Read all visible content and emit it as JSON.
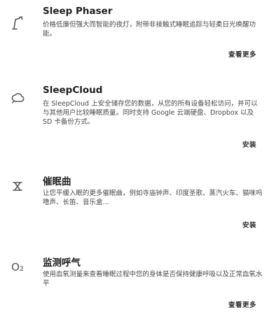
{
  "items": [
    {
      "icon": "lamp-icon",
      "title": "Sleep Phaser",
      "description": "价格低廉但强大而智能的夜灯，附带非接触式睡眠追踪与轻柔日光唤醒功能。",
      "action": "查看更多"
    },
    {
      "icon": "cloud-icon",
      "title": "SleepCloud",
      "description": "在 SleepCloud 上安全储存您的数据，从您的所有设备轻松访问，并可以与其他用户比较睡眠质量。同时支持 Google 云端硬盘、Dropbox 以及 SD 卡备份方式。",
      "action": "安装"
    },
    {
      "icon": "hourglass-icon",
      "title": "催眠曲",
      "description": "让您平缓入眠的更多催眠曲，例如寺庙钟声、印度圣歌、蒸汽火车、猫咪呜噜声、长笛、音乐盒...",
      "action": "安装"
    },
    {
      "icon": "o2-icon",
      "icon_text": "O₂",
      "title": "监测呼气",
      "description": "使用血氧测量来查看睡眠过程中您的身体是否保持健康呼吸以及正常血氧水平",
      "action": "查看更多"
    }
  ]
}
